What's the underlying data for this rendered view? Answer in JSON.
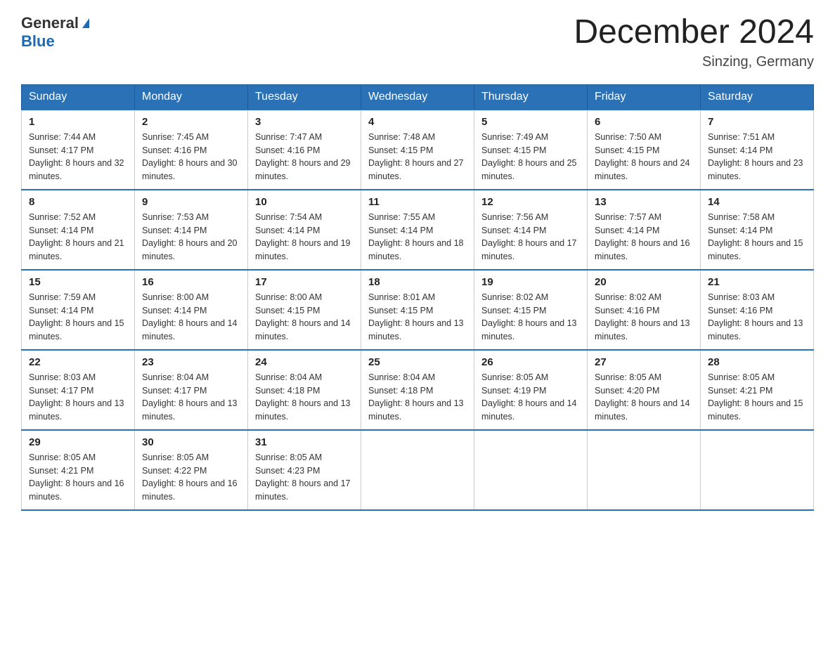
{
  "logo": {
    "line1": "General",
    "line2": "Blue"
  },
  "title": "December 2024",
  "location": "Sinzing, Germany",
  "headers": [
    "Sunday",
    "Monday",
    "Tuesday",
    "Wednesday",
    "Thursday",
    "Friday",
    "Saturday"
  ],
  "weeks": [
    [
      {
        "day": "1",
        "sunrise": "7:44 AM",
        "sunset": "4:17 PM",
        "daylight": "8 hours and 32 minutes."
      },
      {
        "day": "2",
        "sunrise": "7:45 AM",
        "sunset": "4:16 PM",
        "daylight": "8 hours and 30 minutes."
      },
      {
        "day": "3",
        "sunrise": "7:47 AM",
        "sunset": "4:16 PM",
        "daylight": "8 hours and 29 minutes."
      },
      {
        "day": "4",
        "sunrise": "7:48 AM",
        "sunset": "4:15 PM",
        "daylight": "8 hours and 27 minutes."
      },
      {
        "day": "5",
        "sunrise": "7:49 AM",
        "sunset": "4:15 PM",
        "daylight": "8 hours and 25 minutes."
      },
      {
        "day": "6",
        "sunrise": "7:50 AM",
        "sunset": "4:15 PM",
        "daylight": "8 hours and 24 minutes."
      },
      {
        "day": "7",
        "sunrise": "7:51 AM",
        "sunset": "4:14 PM",
        "daylight": "8 hours and 23 minutes."
      }
    ],
    [
      {
        "day": "8",
        "sunrise": "7:52 AM",
        "sunset": "4:14 PM",
        "daylight": "8 hours and 21 minutes."
      },
      {
        "day": "9",
        "sunrise": "7:53 AM",
        "sunset": "4:14 PM",
        "daylight": "8 hours and 20 minutes."
      },
      {
        "day": "10",
        "sunrise": "7:54 AM",
        "sunset": "4:14 PM",
        "daylight": "8 hours and 19 minutes."
      },
      {
        "day": "11",
        "sunrise": "7:55 AM",
        "sunset": "4:14 PM",
        "daylight": "8 hours and 18 minutes."
      },
      {
        "day": "12",
        "sunrise": "7:56 AM",
        "sunset": "4:14 PM",
        "daylight": "8 hours and 17 minutes."
      },
      {
        "day": "13",
        "sunrise": "7:57 AM",
        "sunset": "4:14 PM",
        "daylight": "8 hours and 16 minutes."
      },
      {
        "day": "14",
        "sunrise": "7:58 AM",
        "sunset": "4:14 PM",
        "daylight": "8 hours and 15 minutes."
      }
    ],
    [
      {
        "day": "15",
        "sunrise": "7:59 AM",
        "sunset": "4:14 PM",
        "daylight": "8 hours and 15 minutes."
      },
      {
        "day": "16",
        "sunrise": "8:00 AM",
        "sunset": "4:14 PM",
        "daylight": "8 hours and 14 minutes."
      },
      {
        "day": "17",
        "sunrise": "8:00 AM",
        "sunset": "4:15 PM",
        "daylight": "8 hours and 14 minutes."
      },
      {
        "day": "18",
        "sunrise": "8:01 AM",
        "sunset": "4:15 PM",
        "daylight": "8 hours and 13 minutes."
      },
      {
        "day": "19",
        "sunrise": "8:02 AM",
        "sunset": "4:15 PM",
        "daylight": "8 hours and 13 minutes."
      },
      {
        "day": "20",
        "sunrise": "8:02 AM",
        "sunset": "4:16 PM",
        "daylight": "8 hours and 13 minutes."
      },
      {
        "day": "21",
        "sunrise": "8:03 AM",
        "sunset": "4:16 PM",
        "daylight": "8 hours and 13 minutes."
      }
    ],
    [
      {
        "day": "22",
        "sunrise": "8:03 AM",
        "sunset": "4:17 PM",
        "daylight": "8 hours and 13 minutes."
      },
      {
        "day": "23",
        "sunrise": "8:04 AM",
        "sunset": "4:17 PM",
        "daylight": "8 hours and 13 minutes."
      },
      {
        "day": "24",
        "sunrise": "8:04 AM",
        "sunset": "4:18 PM",
        "daylight": "8 hours and 13 minutes."
      },
      {
        "day": "25",
        "sunrise": "8:04 AM",
        "sunset": "4:18 PM",
        "daylight": "8 hours and 13 minutes."
      },
      {
        "day": "26",
        "sunrise": "8:05 AM",
        "sunset": "4:19 PM",
        "daylight": "8 hours and 14 minutes."
      },
      {
        "day": "27",
        "sunrise": "8:05 AM",
        "sunset": "4:20 PM",
        "daylight": "8 hours and 14 minutes."
      },
      {
        "day": "28",
        "sunrise": "8:05 AM",
        "sunset": "4:21 PM",
        "daylight": "8 hours and 15 minutes."
      }
    ],
    [
      {
        "day": "29",
        "sunrise": "8:05 AM",
        "sunset": "4:21 PM",
        "daylight": "8 hours and 16 minutes."
      },
      {
        "day": "30",
        "sunrise": "8:05 AM",
        "sunset": "4:22 PM",
        "daylight": "8 hours and 16 minutes."
      },
      {
        "day": "31",
        "sunrise": "8:05 AM",
        "sunset": "4:23 PM",
        "daylight": "8 hours and 17 minutes."
      },
      null,
      null,
      null,
      null
    ]
  ]
}
